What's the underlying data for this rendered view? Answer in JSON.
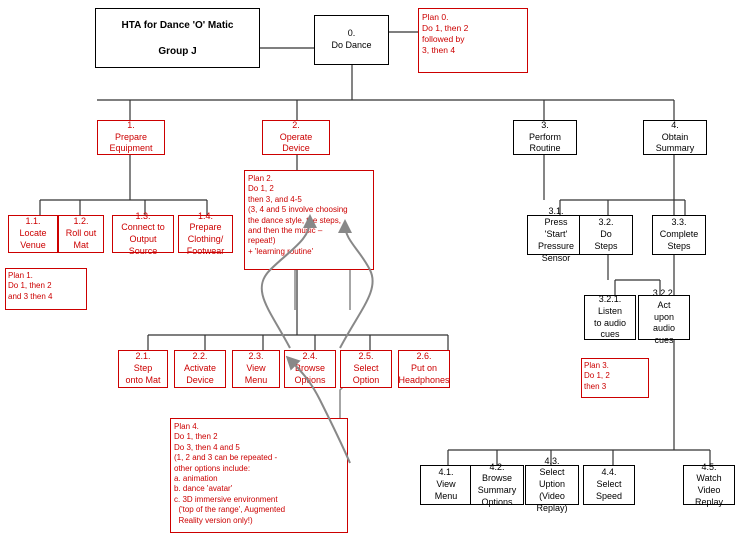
{
  "title": "HTA for Dance 'O' Matic",
  "subtitle": "Group J",
  "boxes": {
    "title": {
      "text": "HTA for Dance 'O' Matic\n\nGroup J"
    },
    "n0": {
      "text": "0.\nDo Dance"
    },
    "plan0": {
      "text": "Plan 0.\nDo 1, then 2\nfollowed by\n3, then 4"
    },
    "n1": {
      "text": "1.\nPrepare\nEquipment"
    },
    "n2": {
      "text": "2.\nOperate\nDevice"
    },
    "n3": {
      "text": "3.\nPerform\nRoutine"
    },
    "n4": {
      "text": "4.\nObtain\nSummary"
    },
    "n11": {
      "text": "1.1.\nLocate\nVenue"
    },
    "n12": {
      "text": "1.2.\nRoll out\nMat"
    },
    "n13": {
      "text": "1.3.\nConnect to\nOutput Source"
    },
    "n14": {
      "text": "1.4.\nPrepare\nClothing/\nFootwear"
    },
    "plan1": {
      "text": "Plan 1.\nDo 1, then 2\nand 3 then 4"
    },
    "plan2": {
      "text": "Plan 2.\nDo 1, 2\nthen 3, and 4-5\n(3, 4 and 5 involve choosing\nthe dance style, the steps,\nand then the music –\nrepeat!)\n+ 'learning routine'"
    },
    "n21": {
      "text": "2.1.\nStep\nonto Mat"
    },
    "n22": {
      "text": "2.2.\nActivate\nDevice"
    },
    "n23": {
      "text": "2.3.\nView\nMenu"
    },
    "n24": {
      "text": "2.4.\nBrowse\nOptions"
    },
    "n25": {
      "text": "2.5.\nSelect\nOption"
    },
    "n26": {
      "text": "2.6.\nPut on\nHeadphones"
    },
    "n31": {
      "text": "3.1.\nPress\n'Start'\nPressure\nSensor"
    },
    "n32": {
      "text": "3.2.\nDo\nSteps"
    },
    "n33": {
      "text": "3.3.\nComplete\nSteps"
    },
    "n321": {
      "text": "3.2.1.\nListen\nto audio\ncues"
    },
    "n322": {
      "text": "3.2.2.\nAct\nupon\naudio\ncues"
    },
    "plan3": {
      "text": "Plan 3.\nDo 1, 2\nthen 3"
    },
    "plan4": {
      "text": "Plan 4.\nDo 1, then 2\nDo 3, then 4 and 5\n(1, 2 and 3 can be repeated -\nother options include:\na. animation\nb. dance 'avatar'\nc. 3D immersive environment\n   ('top of the range', Augmented\n   Reality version only!)"
    },
    "n41": {
      "text": "4.1.\nView\nMenu"
    },
    "n42": {
      "text": "4.2.\nBrowse\nSummary\nOptions"
    },
    "n43": {
      "text": "4.3.\nSelect\nUption\n(Video\nReplay)"
    },
    "n44": {
      "text": "4.4.\nSelect\nSpeed"
    },
    "n45": {
      "text": "4.5.\nWatch\nVideo\nReplay"
    }
  }
}
